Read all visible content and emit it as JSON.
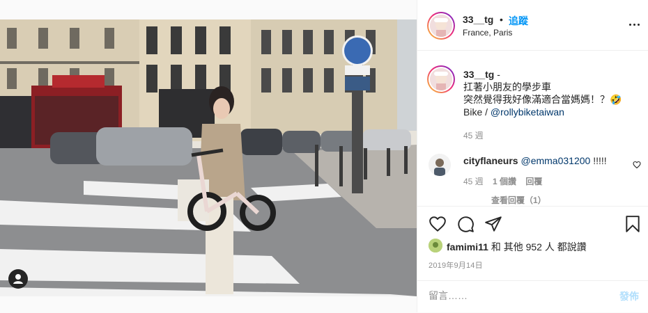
{
  "post": {
    "username": "33__tg",
    "follow_separator": "•",
    "follow_label": "追蹤",
    "location": "France, Paris"
  },
  "caption": {
    "username": "33__tg",
    "suffix": "-",
    "line1": "扛著小朋友的學步車",
    "line2": "突然覺得我好像滿適合當媽媽！？🤣",
    "line3_prefix": "Bike / ",
    "line3_link": "@rollybiketaiwan",
    "time": "45 週"
  },
  "comments": [
    {
      "username": "cityflaneurs",
      "mention": "@emma031200",
      "text": " !!!!!",
      "time": "45 週",
      "likes": "1 個讚",
      "reply": "回覆",
      "view_replies": "查看回覆（1）"
    }
  ],
  "likes": {
    "user": "famimi11",
    "text": " 和 其他 952 人 都說讚"
  },
  "date": "2019年9月14日",
  "comment_box": {
    "placeholder": "留言……",
    "post_label": "發佈"
  },
  "icons": [
    "like-heart-icon",
    "comment-bubble-icon",
    "share-plane-icon",
    "bookmark-icon",
    "more-options-icon",
    "tag-person-icon",
    "small-heart-icon"
  ]
}
